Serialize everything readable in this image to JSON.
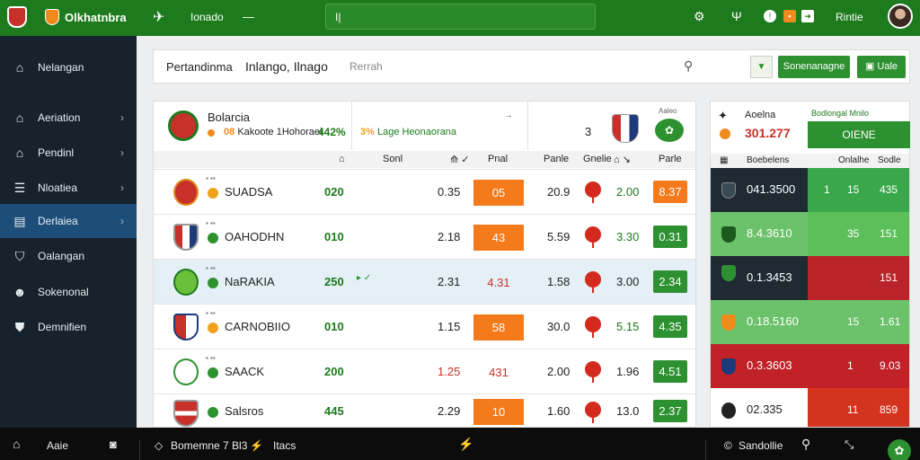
{
  "topbar": {
    "brand": "Olkhatnbra",
    "nav_icon": "✈",
    "link": "Ionado",
    "menu": "—",
    "search_value": "I|",
    "icons": [
      "gear-icon",
      "signal-icon",
      "info-icon",
      "flag-icon",
      "share-icon"
    ],
    "user": "Rintie"
  },
  "sidebar": {
    "items": [
      {
        "label": "Nelangan",
        "icon": "home-icon",
        "glyph": "⌂",
        "chevron": false
      },
      {
        "label": "Aeriation",
        "icon": "home-icon",
        "glyph": "⌂",
        "chevron": true
      },
      {
        "label": "Pendinl",
        "icon": "home-icon",
        "glyph": "⌂",
        "chevron": true
      },
      {
        "label": "Nloatiea",
        "icon": "menu-icon",
        "glyph": "☰",
        "chevron": true
      },
      {
        "label": "Derlaiea",
        "icon": "card-icon",
        "glyph": "▤",
        "chevron": true
      },
      {
        "label": "Oalangan",
        "icon": "shield-icon",
        "glyph": "⛉",
        "chevron": false
      },
      {
        "label": "Sokenonal",
        "icon": "user-icon",
        "glyph": "☻",
        "chevron": false
      },
      {
        "label": "Demnifien",
        "icon": "crest-icon",
        "glyph": "⛊",
        "chevron": false
      }
    ]
  },
  "header": {
    "title": "Pertandinma",
    "subtitle": "Inlango, Ilnago",
    "search_placeholder": "Rerrah",
    "button_primary": "Sonenanagne",
    "button_secondary": "Uale"
  },
  "match": {
    "name": "Bolarcia",
    "sub": "Kakoote 1Hohoraei",
    "prefix": "08",
    "pct": "442%",
    "mid_text": "Lage Heonaorana",
    "mid_prefix": "3%",
    "number": "3",
    "tiny_label": "Aaleo"
  },
  "table": {
    "headers": [
      "Sonl",
      "Pnal",
      "Panle",
      "Gnelie",
      "Parle"
    ],
    "rows": [
      {
        "team": "SUADSA",
        "score": "020",
        "v1": "0.35",
        "odd": "05",
        "odd_style": "orange",
        "v2": "20.9",
        "v3": "2.00",
        "box": "8.37",
        "box_style": "orange",
        "bullet": "#f0a21c",
        "highlight": false
      },
      {
        "team": "OAHODHN",
        "score": "010",
        "v1": "2.18",
        "odd": "43",
        "odd_style": "orange",
        "v2": "5.59",
        "v3": "3.30",
        "box": "0.31",
        "box_style": "green",
        "bullet": "#2e9131",
        "highlight": false
      },
      {
        "team": "NaRAKIA",
        "score": "250",
        "v1": "2.31",
        "odd": "4.31",
        "odd_style": "plain",
        "v2": "1.58",
        "v3": "3.00",
        "box": "2.34",
        "box_style": "green",
        "bullet": "#2e9131",
        "highlight": true
      },
      {
        "team": "CARNOBIIO",
        "score": "010",
        "v1": "1.15",
        "odd": "58",
        "odd_style": "orange",
        "v2": "30.0",
        "v3": "5.15",
        "box": "4.35",
        "box_style": "green",
        "bullet": "#f0a21c",
        "highlight": false
      },
      {
        "team": "SAACK",
        "score": "200",
        "v1": "1.25",
        "odd": "431",
        "odd_style": "plain",
        "v2": "2.00",
        "v3": "1.96",
        "box": "4.51",
        "box_style": "green",
        "bullet": "#2e9131",
        "highlight": false
      },
      {
        "team": "Salsros",
        "score": "445",
        "v1": "2.29",
        "odd": "10",
        "odd_style": "orange",
        "v2": "1.60",
        "v3": "13.0",
        "box": "2.37",
        "box_style": "green",
        "bullet": "#2e9131",
        "highlight": false
      }
    ]
  },
  "right_panel": {
    "name": "Aoelna",
    "value": "301.277",
    "green_text": "Bodlongal Mnilo",
    "button": "OIENE",
    "headers": [
      "Boebelens",
      "Onlalhe",
      "Sodle"
    ],
    "rows": [
      {
        "value": "041.3500",
        "a": "1",
        "b": "15",
        "c": "435",
        "left_bg": "#1f2a33",
        "right_bg": "#3aa84a"
      },
      {
        "value": "8.4.3610",
        "a": "",
        "b": "35",
        "c": "151",
        "left_bg": "#6cc26a",
        "right_bg": "#5cbf5a"
      },
      {
        "value": "0.1.3453",
        "a": "",
        "b": "",
        "c": "151",
        "left_bg": "#1f2a33",
        "right_bg": "#b8242a"
      },
      {
        "value": "0.18.5160",
        "a": "",
        "b": "15",
        "c": "1.61",
        "left_bg": "#6cc26a",
        "right_bg": "#6cc26a"
      },
      {
        "value": "0.3.3603",
        "a": "",
        "b": "1",
        "c": "9.03",
        "left_bg": "#c02228",
        "right_bg": "#c02228"
      },
      {
        "value": "02.335",
        "a": "",
        "b": "11",
        "c": "859",
        "left_bg": "#ffffff",
        "right_bg": "#d4331e"
      }
    ]
  },
  "bottom": {
    "left": "Aaie",
    "center": "Bomemne 7 Bl3",
    "center2": "Itacs",
    "right": "Sandollie"
  }
}
